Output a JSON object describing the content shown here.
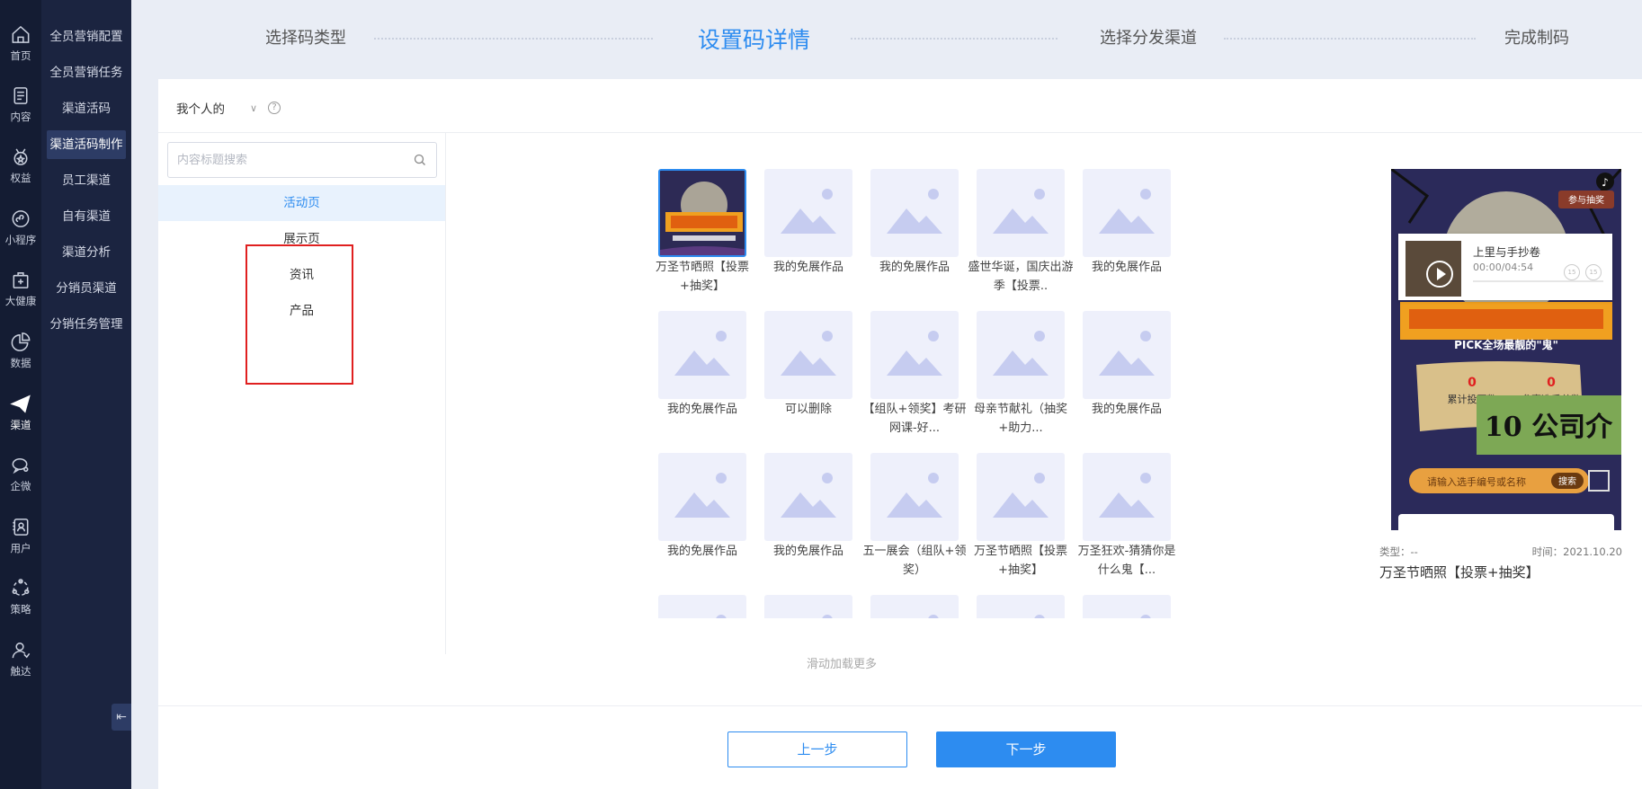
{
  "rail": [
    {
      "label": "首页",
      "icon": "home-icon"
    },
    {
      "label": "内容",
      "icon": "document-icon"
    },
    {
      "label": "权益",
      "icon": "medal-icon"
    },
    {
      "label": "小程序",
      "icon": "miniprogram-icon"
    },
    {
      "label": "大健康",
      "icon": "health-kit-icon"
    },
    {
      "label": "数据",
      "icon": "pie-chart-icon"
    },
    {
      "label": "渠道",
      "icon": "paper-plane-icon",
      "active": true
    },
    {
      "label": "企微",
      "icon": "chat-icon"
    },
    {
      "label": "用户",
      "icon": "contact-card-icon"
    },
    {
      "label": "策略",
      "icon": "strategy-icon"
    },
    {
      "label": "触达",
      "icon": "user-reach-icon"
    }
  ],
  "subnav": [
    "全员营销配置",
    "全员营销任务",
    "渠道活码",
    "渠道活码制作",
    "员工渠道",
    "自有渠道",
    "渠道分析",
    "分销员渠道",
    "分销任务管理"
  ],
  "subnav_active": "渠道活码制作",
  "steps": [
    "选择码类型",
    "设置码详情",
    "选择分发渠道",
    "完成制码"
  ],
  "step_active": "设置码详情",
  "scope": {
    "label": "我个人的"
  },
  "search": {
    "placeholder": "内容标题搜索"
  },
  "categories": [
    "活动页",
    "展示页",
    "资讯",
    "产品"
  ],
  "category_active": "活动页",
  "items": [
    "万圣节晒照【投票+抽奖】",
    "我的免展作品",
    "我的免展作品",
    "盛世华诞，国庆出游季【投票..",
    "我的免展作品",
    "我的免展作品",
    "可以删除",
    "【组队+领奖】考研网课-好...",
    "母亲节献礼（抽奖+助力...",
    "我的免展作品",
    "我的免展作品",
    "我的免展作品",
    "五一展会（组队+领奖）",
    "万圣节晒照【投票+抽奖】",
    "万圣狂欢-猜猜你是什么鬼【..."
  ],
  "preview": {
    "audio_title": "上里与手抄卷",
    "audio_time": "00:00/04:54",
    "badge": "参与抽奖",
    "banner_sub": "PICK全场最靓的\"鬼\"",
    "stat1_value": "0",
    "stat1_label": "累计投票数",
    "stat2_value": "0",
    "stat2_label": "参赛选手总数",
    "ad_text": "10 公司介",
    "search_hint": "请输入选手编号或名称",
    "search_btn": "搜索",
    "type_label": "类型：--",
    "time_label": "时间：2021.10.20",
    "title": "万圣节晒照【投票+抽奖】"
  },
  "load_more": "滑动加载更多",
  "buttons": {
    "prev": "上一步",
    "next": "下一步"
  },
  "colors": {
    "accent": "#2d8cf0",
    "rail_bg": "#141c33",
    "subnav_bg": "#1b2440",
    "highlight_box": "#e02020"
  }
}
